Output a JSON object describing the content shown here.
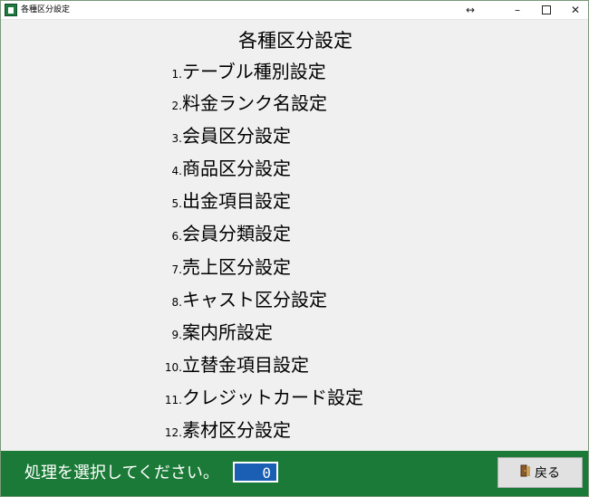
{
  "window": {
    "title": "各種区分設定",
    "resize_glyph": "↔",
    "min_glyph": "–",
    "close_glyph": "✕"
  },
  "heading": "各種区分設定",
  "menu": [
    {
      "num": "1.",
      "label": "テーブル種別設定"
    },
    {
      "num": "2.",
      "label": "料金ランク名設定"
    },
    {
      "num": "3.",
      "label": "会員区分設定"
    },
    {
      "num": "4.",
      "label": "商品区分設定"
    },
    {
      "num": "5.",
      "label": "出金項目設定"
    },
    {
      "num": "6.",
      "label": "会員分類設定"
    },
    {
      "num": "7.",
      "label": "売上区分設定"
    },
    {
      "num": "8.",
      "label": "キャスト区分設定"
    },
    {
      "num": "9.",
      "label": "案内所設定"
    },
    {
      "num": "10.",
      "label": "立替金項目設定"
    },
    {
      "num": "11.",
      "label": "クレジットカード設定"
    },
    {
      "num": "12.",
      "label": "素材区分設定"
    }
  ],
  "footer": {
    "prompt": "処理を選択してください。",
    "selection_value": "0",
    "back_label": "戻る",
    "back_icon": "door-exit-icon",
    "bg_color": "#1b7a37"
  }
}
